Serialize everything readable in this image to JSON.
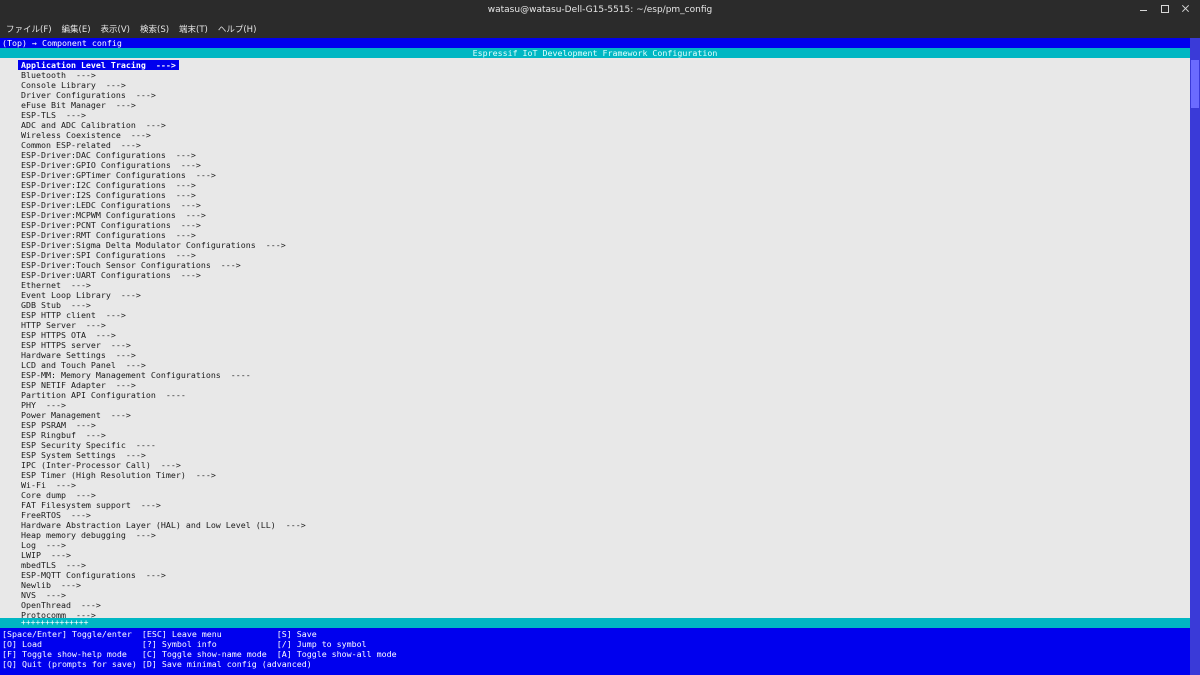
{
  "window": {
    "title": "watasu@watasu-Dell-G15-5515: ~/esp/pm_config"
  },
  "menubar": [
    "ファイル(F)",
    "編集(E)",
    "表示(V)",
    "検索(S)",
    "端末(T)",
    "ヘルプ(H)"
  ],
  "breadcrumb": "(Top) → Component config",
  "config_title": "Espressif IoT Development Framework Configuration",
  "items": [
    "Application Level Tracing  --->",
    "Bluetooth  --->",
    "Console Library  --->",
    "Driver Configurations  --->",
    "eFuse Bit Manager  --->",
    "ESP-TLS  --->",
    "ADC and ADC Calibration  --->",
    "Wireless Coexistence  --->",
    "Common ESP-related  --->",
    "ESP-Driver:DAC Configurations  --->",
    "ESP-Driver:GPIO Configurations  --->",
    "ESP-Driver:GPTimer Configurations  --->",
    "ESP-Driver:I2C Configurations  --->",
    "ESP-Driver:I2S Configurations  --->",
    "ESP-Driver:LEDC Configurations  --->",
    "ESP-Driver:MCPWM Configurations  --->",
    "ESP-Driver:PCNT Configurations  --->",
    "ESP-Driver:RMT Configurations  --->",
    "ESP-Driver:Sigma Delta Modulator Configurations  --->",
    "ESP-Driver:SPI Configurations  --->",
    "ESP-Driver:Touch Sensor Configurations  --->",
    "ESP-Driver:UART Configurations  --->",
    "Ethernet  --->",
    "Event Loop Library  --->",
    "GDB Stub  --->",
    "ESP HTTP client  --->",
    "HTTP Server  --->",
    "ESP HTTPS OTA  --->",
    "ESP HTTPS server  --->",
    "Hardware Settings  --->",
    "LCD and Touch Panel  --->",
    "ESP-MM: Memory Management Configurations  ----",
    "ESP NETIF Adapter  --->",
    "Partition API Configuration  ----",
    "PHY  --->",
    "Power Management  --->",
    "ESP PSRAM  --->",
    "ESP Ringbuf  --->",
    "ESP Security Specific  ----",
    "ESP System Settings  --->",
    "IPC (Inter-Processor Call)  --->",
    "ESP Timer (High Resolution Timer)  --->",
    "Wi-Fi  --->",
    "Core dump  --->",
    "FAT Filesystem support  --->",
    "FreeRTOS  --->",
    "Hardware Abstraction Layer (HAL) and Low Level (LL)  --->",
    "Heap memory debugging  --->",
    "Log  --->",
    "LWIP  --->",
    "mbedTLS  --->",
    "ESP-MQTT Configurations  --->",
    "Newlib  --->",
    "NVS  --->",
    "OpenThread  --->",
    "Protocomm  --->"
  ],
  "selected_index": 0,
  "more_indicator": "++++++++++++++",
  "help_lines": [
    "[Space/Enter] Toggle/enter  [ESC] Leave menu           [S] Save",
    "[O] Load                    [?] Symbol info            [/] Jump to symbol",
    "[F] Toggle show-help mode   [C] Toggle show-name mode  [A] Toggle show-all mode",
    "[Q] Quit (prompts for save) [D] Save minimal config (advanced)"
  ],
  "colors": {
    "terminal_blue": "#0000ee",
    "cyan_bar": "#00b7c3",
    "panel_bg": "#e8e8e8",
    "window_chrome": "#2b2b2b"
  }
}
